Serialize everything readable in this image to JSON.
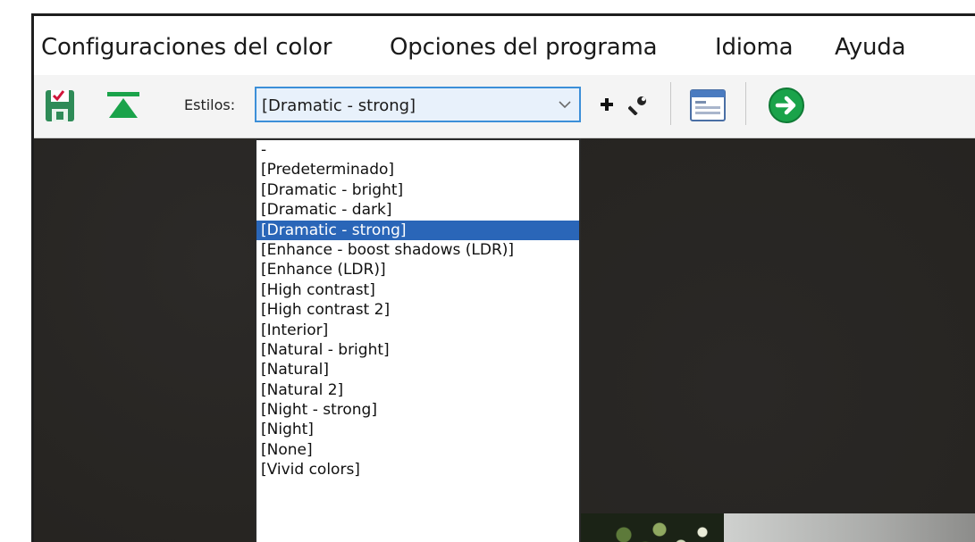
{
  "menubar": {
    "items": [
      {
        "label": "Configuraciones del color"
      },
      {
        "label": "Opciones del programa"
      },
      {
        "label": "Idioma"
      },
      {
        "label": "Ayuda"
      }
    ]
  },
  "toolbar": {
    "save_icon": "save-disk-icon",
    "collapse_icon": "green-triangle-icon",
    "styles_label": "Estilos:",
    "styles_value": "[Dramatic - strong]",
    "add_icon": "plus-icon",
    "wrench_icon": "wrench-icon",
    "window_icon": "window-layout-icon",
    "next_icon": "green-arrow-right-icon"
  },
  "dropdown": {
    "selected_index": 4,
    "options": [
      "-",
      "[Predeterminado]",
      "[Dramatic - bright]",
      "[Dramatic - dark]",
      "[Dramatic - strong]",
      "[Enhance - boost shadows (LDR)]",
      "[Enhance (LDR)]",
      "[High contrast]",
      "[High contrast 2]",
      "[Interior]",
      "[Natural - bright]",
      "[Natural]",
      "[Natural 2]",
      "[Night - strong]",
      "[Night]",
      "[None]",
      "[Vivid colors]"
    ]
  },
  "colors": {
    "selection": "#2a66b8",
    "combo_border": "#3c8fd8",
    "canvas_bg": "#262421",
    "accent_green": "#1aa34a"
  }
}
